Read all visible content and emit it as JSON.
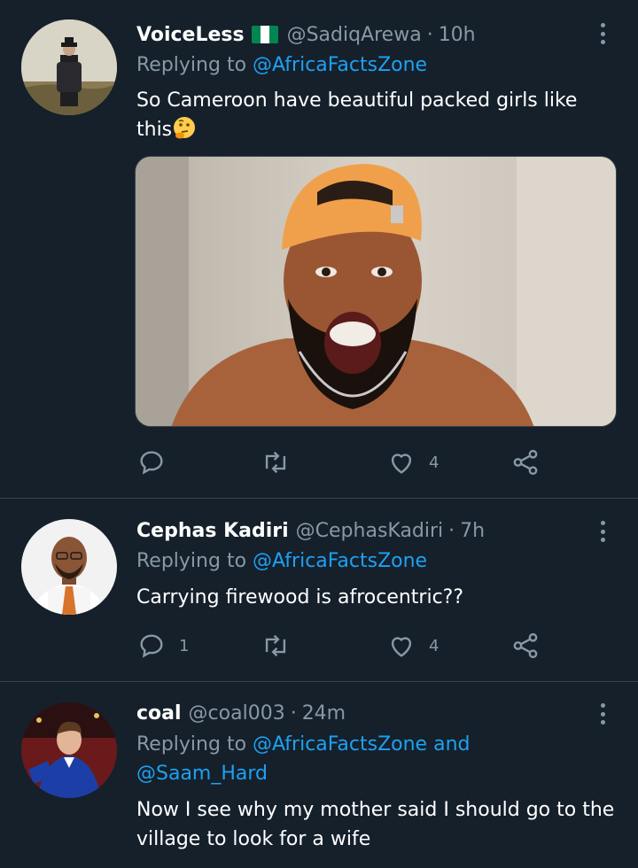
{
  "colors": {
    "background": "#15202b",
    "divider": "#38444d",
    "muted": "#8899a6",
    "link": "#1da1f2",
    "text": "#ffffff"
  },
  "tweets": [
    {
      "name": "VoiceLess",
      "flag_icon": "nigeria-flag",
      "handle": "@SadiqArewa",
      "time": "10h",
      "replying_prefix": "Replying to",
      "mention_1": "@AfricaFactsZone",
      "text": "So Cameroon have beautiful packed girls like this",
      "emoji_icon": "thinking-face",
      "media": "photo of shirtless man in orange cap shouting",
      "reply_count": "",
      "retweet_count": "",
      "like_count": "4"
    },
    {
      "name": "Cephas Kadiri",
      "handle": "@CephasKadiri",
      "time": "7h",
      "replying_prefix": "Replying to",
      "mention_1": "@AfricaFactsZone",
      "text": "Carrying firewood is afrocentric??",
      "reply_count": "1",
      "retweet_count": "",
      "like_count": "4"
    },
    {
      "name": "coal",
      "handle": "@coal003",
      "time": "24m",
      "replying_prefix": "Replying to",
      "mention_1": "@AfricaFactsZone",
      "conjunction": "and",
      "mention_2": "@Saam_Hard",
      "text": "Now I see why my mother said I should go to the village to look for a wife"
    }
  ],
  "dot": "·",
  "icons": [
    "more-vertical-icon",
    "reply-icon",
    "retweet-icon",
    "like-icon",
    "share-icon"
  ]
}
